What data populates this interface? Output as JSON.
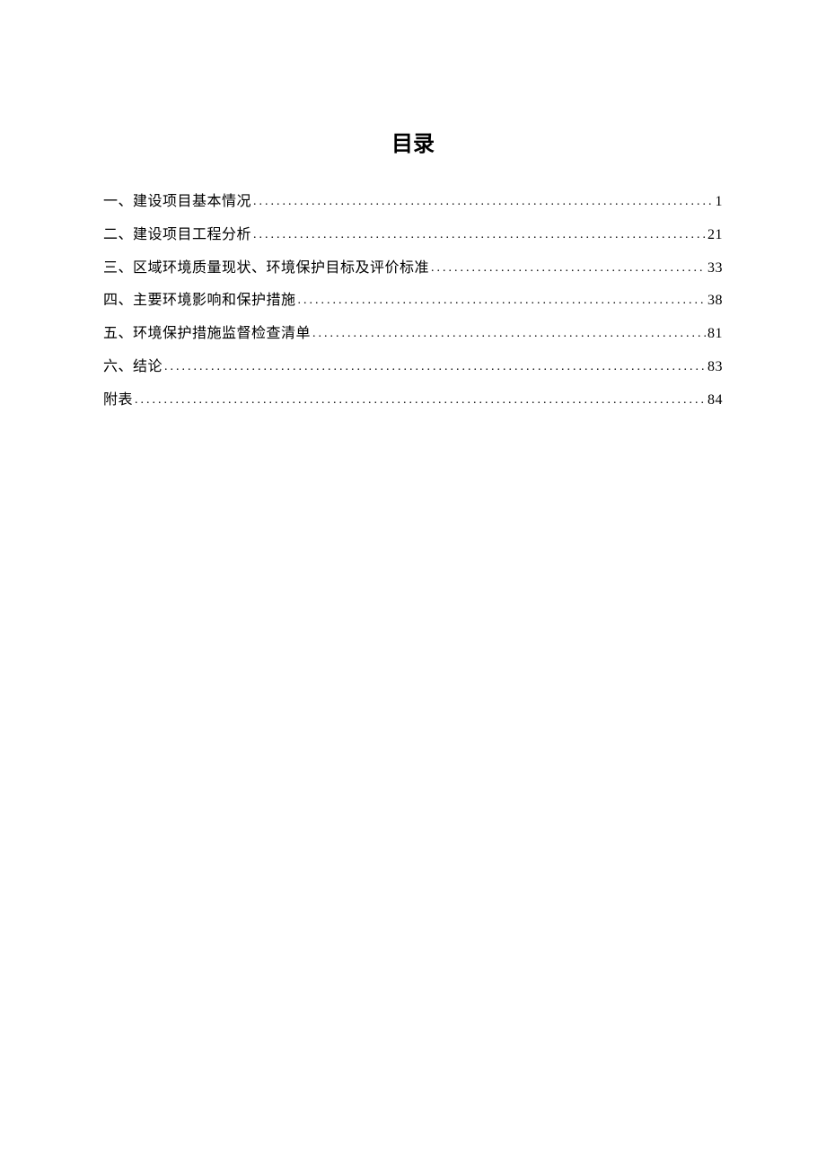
{
  "title": "目录",
  "toc": [
    {
      "label": "一、建设项目基本情况",
      "page": "1"
    },
    {
      "label": "二、建设项目工程分析",
      "page": "21"
    },
    {
      "label": "三、区域环境质量现状、环境保护目标及评价标准",
      "page": "33"
    },
    {
      "label": "四、主要环境影响和保护措施",
      "page": "38"
    },
    {
      "label": "五、环境保护措施监督检查清单",
      "page": "81"
    },
    {
      "label": "六、结论",
      "page": "83"
    },
    {
      "label": "附表",
      "page": "84"
    }
  ]
}
